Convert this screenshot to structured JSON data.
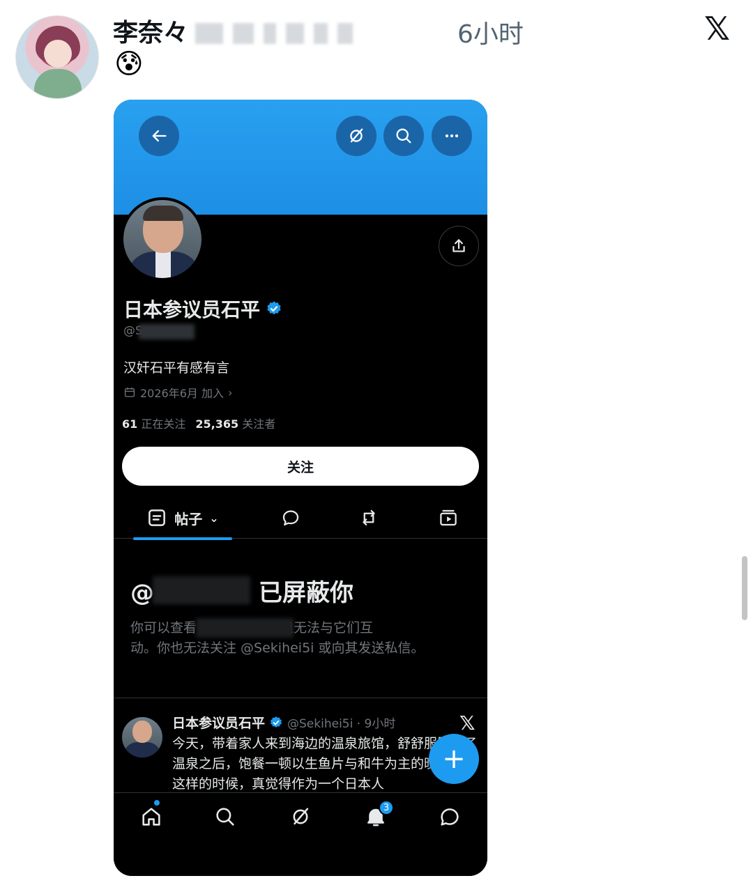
{
  "tweet": {
    "author_name": "李奈々",
    "time": "6小时",
    "emoji": "😰",
    "x_logo": "𝕏"
  },
  "profile": {
    "display_name": "日本参议员石平",
    "handle_visible": "@S",
    "bio": "汉奸石平有感有言",
    "joined": "2026年6月 加入",
    "following_count": "61",
    "following_label": "正在关注",
    "followers_count": "25,365",
    "followers_label": "关注者",
    "follow_button": "关注",
    "posts_tab": "帖子"
  },
  "blocked": {
    "title_prefix": "@",
    "title_suffix": "已屏蔽你",
    "line1": "你可以查看 的公开帖子，但无法与它们互",
    "line2": "动。你也无法关注 @Sekihei5i 或向其发送私信。"
  },
  "post": {
    "author": "日本参议员石平",
    "meta": "@Sekihei5i · 9小时",
    "x_logo": "𝕏",
    "text": "今天，带着家人来到海边的温泉旅馆，舒舒服服泡了温泉之后，饱餐一顿以生鱼片与和牛为主的晚宴。在这样的时候，真觉得作为一个日本人"
  },
  "fab_label": "+",
  "nav": {
    "notification_badge": "3"
  },
  "colors": {
    "accent": "#1d9bf0",
    "banner": "#1d8fe6",
    "dark_bg": "#000000"
  }
}
